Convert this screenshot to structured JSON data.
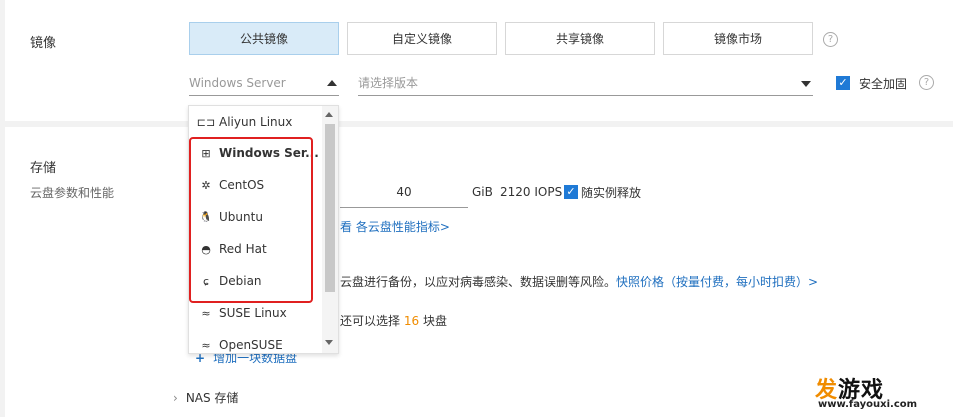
{
  "image_section": {
    "label": "镜像",
    "tabs": [
      {
        "label": "公共镜像",
        "active": true
      },
      {
        "label": "自定义镜像",
        "active": false
      },
      {
        "label": "共享镜像",
        "active": false
      },
      {
        "label": "镜像市场",
        "active": false
      }
    ],
    "help_glyph": "?",
    "os_select_value": "Windows Server",
    "version_select_placeholder": "请选择版本",
    "security_checkbox_label": "安全加固",
    "security_checked": true
  },
  "storage_section": {
    "label": "存储",
    "sublabel": "云盘参数和性能",
    "disk_size": "40",
    "disk_unit": "GiB",
    "iops": "2120 IOPS",
    "release_checkbox_label": "随实例释放",
    "release_checked": true,
    "perf_link_partial": "看 各云盘性能指标>",
    "snapshot_text": "云盘进行备份，以应对病毒感染、数据误删等风险。",
    "snapshot_link": "快照价格（按量付费，每小时扣费）>",
    "remaining_text_prefix": "还可以选择",
    "remaining_count": "16",
    "remaining_text_suffix": "块盘",
    "add_disk_label": "增加一块数据盘",
    "nas_label": "NAS 存储"
  },
  "dropdown": {
    "items": [
      {
        "label": "Aliyun Linux",
        "icon": "aliyun-icon",
        "glyph": "⊏⊐",
        "bold": false
      },
      {
        "label": "Windows Ser...",
        "icon": "windows-icon",
        "glyph": "⊞",
        "bold": true
      },
      {
        "label": "CentOS",
        "icon": "centos-icon",
        "glyph": "✲",
        "bold": false
      },
      {
        "label": "Ubuntu",
        "icon": "ubuntu-penguin-icon",
        "glyph": "🐧",
        "bold": false
      },
      {
        "label": "Red Hat",
        "icon": "redhat-icon",
        "glyph": "◓",
        "bold": false
      },
      {
        "label": "Debian",
        "icon": "debian-icon",
        "glyph": "ɕ",
        "bold": false
      },
      {
        "label": "SUSE Linux",
        "icon": "suse-icon",
        "glyph": "≈",
        "bold": false
      },
      {
        "label": "OpenSUSE",
        "icon": "opensuse-icon",
        "glyph": "≈",
        "bold": false
      }
    ]
  },
  "watermark": {
    "text_a": "发",
    "text_b": "游戏",
    "url": "www.fayouxi.com"
  },
  "colors": {
    "accent": "#1f7ad6",
    "active_tab_bg": "#d9ebf8",
    "highlight": "#e02020",
    "orange": "#f08c00"
  }
}
